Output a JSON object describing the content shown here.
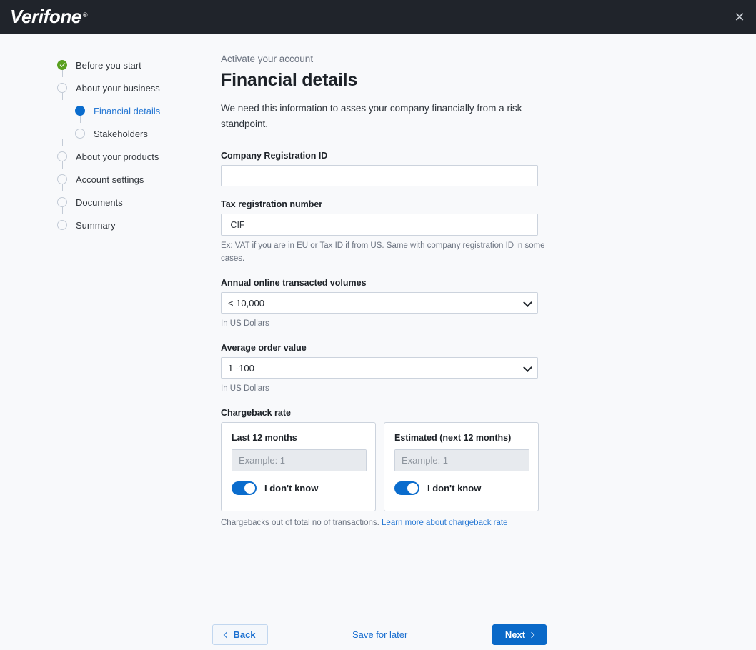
{
  "header": {
    "logo_text": "Verifone",
    "logo_registered": "®",
    "close_icon": "close-icon"
  },
  "sidebar": {
    "steps": [
      {
        "label": "Before you start",
        "state": "done",
        "level": 1
      },
      {
        "label": "About your business",
        "state": "pending",
        "level": 1
      },
      {
        "label": "Financial details",
        "state": "current",
        "level": 2
      },
      {
        "label": "Stakeholders",
        "state": "pending",
        "level": 2
      },
      {
        "label": "About your products",
        "state": "pending",
        "level": 1
      },
      {
        "label": "Account settings",
        "state": "pending",
        "level": 1
      },
      {
        "label": "Documents",
        "state": "pending",
        "level": 1
      },
      {
        "label": "Summary",
        "state": "pending",
        "level": 1
      }
    ]
  },
  "main": {
    "eyebrow": "Activate your account",
    "title": "Financial details",
    "intro": "We need this information to asses your company financially from a risk standpoint.",
    "company_registration": {
      "label": "Company Registration ID",
      "value": "",
      "placeholder": ""
    },
    "tax_registration": {
      "label": "Tax registration number",
      "prefix": "CIF",
      "value": "",
      "placeholder": "",
      "help": "Ex: VAT if you are in EU or Tax ID if from US. Same with company registration ID in some cases."
    },
    "annual_volumes": {
      "label": "Annual online transacted volumes",
      "selected": "< 10,000",
      "help": "In US Dollars"
    },
    "average_order": {
      "label": "Average order value",
      "selected": "1 -100",
      "help": "In US Dollars"
    },
    "chargeback": {
      "label": "Chargeback rate",
      "cards": [
        {
          "title": "Last 12 months",
          "input_value": "",
          "input_placeholder": "Example: 1",
          "suffix": "%",
          "toggle_label": "I don't know",
          "toggle_on": true
        },
        {
          "title": "Estimated (next 12 months)",
          "input_value": "",
          "input_placeholder": "Example: 1",
          "suffix": "%",
          "toggle_label": "I don't know",
          "toggle_on": true
        }
      ],
      "footnote_text": "Chargebacks out of total no of transactions. ",
      "footnote_link": "Learn more about chargeback rate"
    }
  },
  "footer": {
    "back_label": "Back",
    "save_later_label": "Save for later",
    "next_label": "Next"
  },
  "colors": {
    "header_bg": "#20242b",
    "accent_blue": "#0a69c8",
    "link_blue": "#2a7ad4",
    "success_green": "#59a01f",
    "page_bg": "#f8f9fb"
  }
}
